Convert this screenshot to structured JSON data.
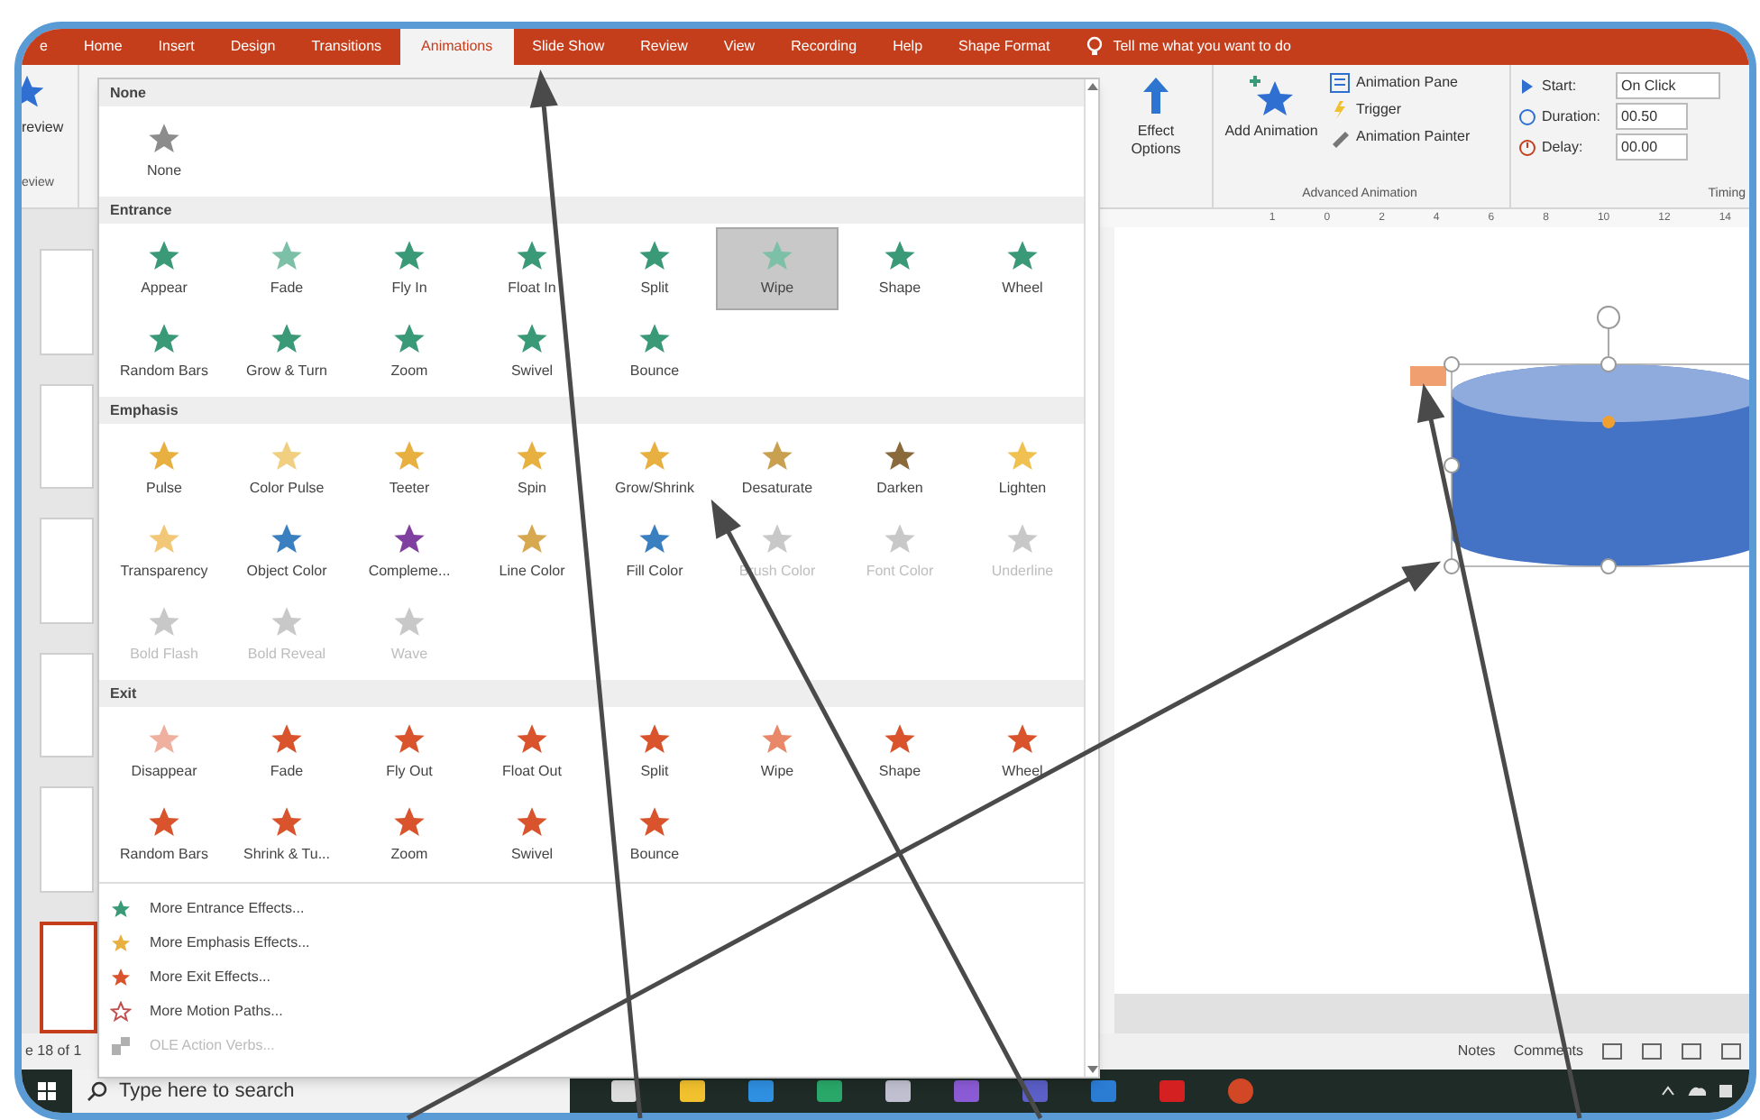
{
  "ribbon": {
    "tabs": [
      {
        "label": "e",
        "selected": false
      },
      {
        "label": "Home",
        "selected": false
      },
      {
        "label": "Insert",
        "selected": false
      },
      {
        "label": "Design",
        "selected": false
      },
      {
        "label": "Transitions",
        "selected": false
      },
      {
        "label": "Animations",
        "selected": true
      },
      {
        "label": "Slide Show",
        "selected": false
      },
      {
        "label": "Review",
        "selected": false
      },
      {
        "label": "View",
        "selected": false
      },
      {
        "label": "Recording",
        "selected": false
      },
      {
        "label": "Help",
        "selected": false
      },
      {
        "label": "Shape Format",
        "selected": false
      }
    ],
    "tell_me": "Tell me what you want to do",
    "preview": {
      "label": "review",
      "group": "eview"
    },
    "effect_options": "Effect Options",
    "add_animation": "Add Animation",
    "advanced": {
      "items": [
        "Animation Pane",
        "Trigger",
        "Animation Painter"
      ],
      "label": "Advanced Animation"
    },
    "timing": {
      "start_label": "Start:",
      "start": "On Click",
      "duration_label": "Duration:",
      "duration": "00.50",
      "delay_label": "Delay:",
      "delay": "00.00",
      "label": "Timing"
    }
  },
  "ruler": [
    "1",
    "0",
    "2",
    "4",
    "6",
    "8",
    "10",
    "12",
    "14"
  ],
  "gallery": {
    "sections": [
      {
        "title": "None",
        "items": [
          {
            "label": "None",
            "color": "#8c8c8c",
            "disabled": false,
            "selected": false
          }
        ]
      },
      {
        "title": "Entrance",
        "items": [
          {
            "label": "Appear",
            "color": "#3a9a78",
            "disabled": false,
            "selected": false
          },
          {
            "label": "Fade",
            "color": "#7cc0a8",
            "disabled": false,
            "selected": false
          },
          {
            "label": "Fly In",
            "color": "#3a9a78",
            "disabled": false,
            "selected": false
          },
          {
            "label": "Float In",
            "color": "#3a9a78",
            "disabled": false,
            "selected": false
          },
          {
            "label": "Split",
            "color": "#3a9a78",
            "disabled": false,
            "selected": false
          },
          {
            "label": "Wipe",
            "color": "#7cc0a8",
            "disabled": false,
            "selected": true
          },
          {
            "label": "Shape",
            "color": "#3a9a78",
            "disabled": false,
            "selected": false
          },
          {
            "label": "Wheel",
            "color": "#3a9a78",
            "disabled": false,
            "selected": false
          },
          {
            "label": "Random Bars",
            "color": "#3a9a78",
            "disabled": false,
            "selected": false
          },
          {
            "label": "Grow & Turn",
            "color": "#3a9a78",
            "disabled": false,
            "selected": false
          },
          {
            "label": "Zoom",
            "color": "#3a9a78",
            "disabled": false,
            "selected": false
          },
          {
            "label": "Swivel",
            "color": "#3a9a78",
            "disabled": false,
            "selected": false
          },
          {
            "label": "Bounce",
            "color": "#3a9a78",
            "disabled": false,
            "selected": false
          }
        ]
      },
      {
        "title": "Emphasis",
        "items": [
          {
            "label": "Pulse",
            "color": "#e8b040",
            "disabled": false,
            "selected": false
          },
          {
            "label": "Color Pulse",
            "color": "#f0d080",
            "disabled": false,
            "selected": false
          },
          {
            "label": "Teeter",
            "color": "#e8b040",
            "disabled": false,
            "selected": false
          },
          {
            "label": "Spin",
            "color": "#e8b040",
            "disabled": false,
            "selected": false
          },
          {
            "label": "Grow/Shrink",
            "color": "#e8b040",
            "disabled": false,
            "selected": false
          },
          {
            "label": "Desaturate",
            "color": "#c9a050",
            "disabled": false,
            "selected": false
          },
          {
            "label": "Darken",
            "color": "#8a6a3a",
            "disabled": false,
            "selected": false
          },
          {
            "label": "Lighten",
            "color": "#f0c050",
            "disabled": false,
            "selected": false
          },
          {
            "label": "Transparency",
            "color": "#f2c878",
            "disabled": false,
            "selected": false
          },
          {
            "label": "Object Color",
            "color": "#3a7fc0",
            "disabled": false,
            "selected": false
          },
          {
            "label": "Compleme...",
            "color": "#8040a0",
            "disabled": false,
            "selected": false
          },
          {
            "label": "Line Color",
            "color": "#d8a850",
            "disabled": false,
            "selected": false
          },
          {
            "label": "Fill Color",
            "color": "#3a7fc0",
            "disabled": false,
            "selected": false
          },
          {
            "label": "Brush Color",
            "color": "#c8c8c8",
            "disabled": true,
            "selected": false
          },
          {
            "label": "Font Color",
            "color": "#c8c8c8",
            "disabled": true,
            "selected": false
          },
          {
            "label": "Underline",
            "color": "#c8c8c8",
            "disabled": true,
            "selected": false
          },
          {
            "label": "Bold Flash",
            "color": "#c8c8c8",
            "disabled": true,
            "selected": false
          },
          {
            "label": "Bold Reveal",
            "color": "#c8c8c8",
            "disabled": true,
            "selected": false
          },
          {
            "label": "Wave",
            "color": "#c8c8c8",
            "disabled": true,
            "selected": false
          }
        ]
      },
      {
        "title": "Exit",
        "items": [
          {
            "label": "Disappear",
            "color": "#f0b0a0",
            "disabled": false,
            "selected": false
          },
          {
            "label": "Fade",
            "color": "#d9532c",
            "disabled": false,
            "selected": false
          },
          {
            "label": "Fly Out",
            "color": "#d9532c",
            "disabled": false,
            "selected": false
          },
          {
            "label": "Float Out",
            "color": "#d9532c",
            "disabled": false,
            "selected": false
          },
          {
            "label": "Split",
            "color": "#d9532c",
            "disabled": false,
            "selected": false
          },
          {
            "label": "Wipe",
            "color": "#e88868",
            "disabled": false,
            "selected": false
          },
          {
            "label": "Shape",
            "color": "#d9532c",
            "disabled": false,
            "selected": false
          },
          {
            "label": "Wheel",
            "color": "#d9532c",
            "disabled": false,
            "selected": false
          },
          {
            "label": "Random Bars",
            "color": "#d9532c",
            "disabled": false,
            "selected": false
          },
          {
            "label": "Shrink & Tu...",
            "color": "#d9532c",
            "disabled": false,
            "selected": false
          },
          {
            "label": "Zoom",
            "color": "#d9532c",
            "disabled": false,
            "selected": false
          },
          {
            "label": "Swivel",
            "color": "#d9532c",
            "disabled": false,
            "selected": false
          },
          {
            "label": "Bounce",
            "color": "#d9532c",
            "disabled": false,
            "selected": false
          }
        ]
      }
    ],
    "menu": [
      {
        "label": "More Entrance Effects...",
        "kind": "star",
        "color": "#3a9a78",
        "disabled": false
      },
      {
        "label": "More Emphasis Effects...",
        "kind": "star",
        "color": "#e8b040",
        "disabled": false
      },
      {
        "label": "More Exit Effects...",
        "kind": "star",
        "color": "#d9532c",
        "disabled": false
      },
      {
        "label": "More Motion Paths...",
        "kind": "path",
        "color": "#c05050",
        "disabled": false
      },
      {
        "label": "OLE Action Verbs...",
        "kind": "verb",
        "color": "#b0b0b0",
        "disabled": true
      }
    ]
  },
  "status_bar": {
    "slide_count": "e 18 of 1",
    "notes": "Notes",
    "comments": "Comments"
  },
  "taskbar": {
    "search_placeholder": "Type here to search"
  }
}
